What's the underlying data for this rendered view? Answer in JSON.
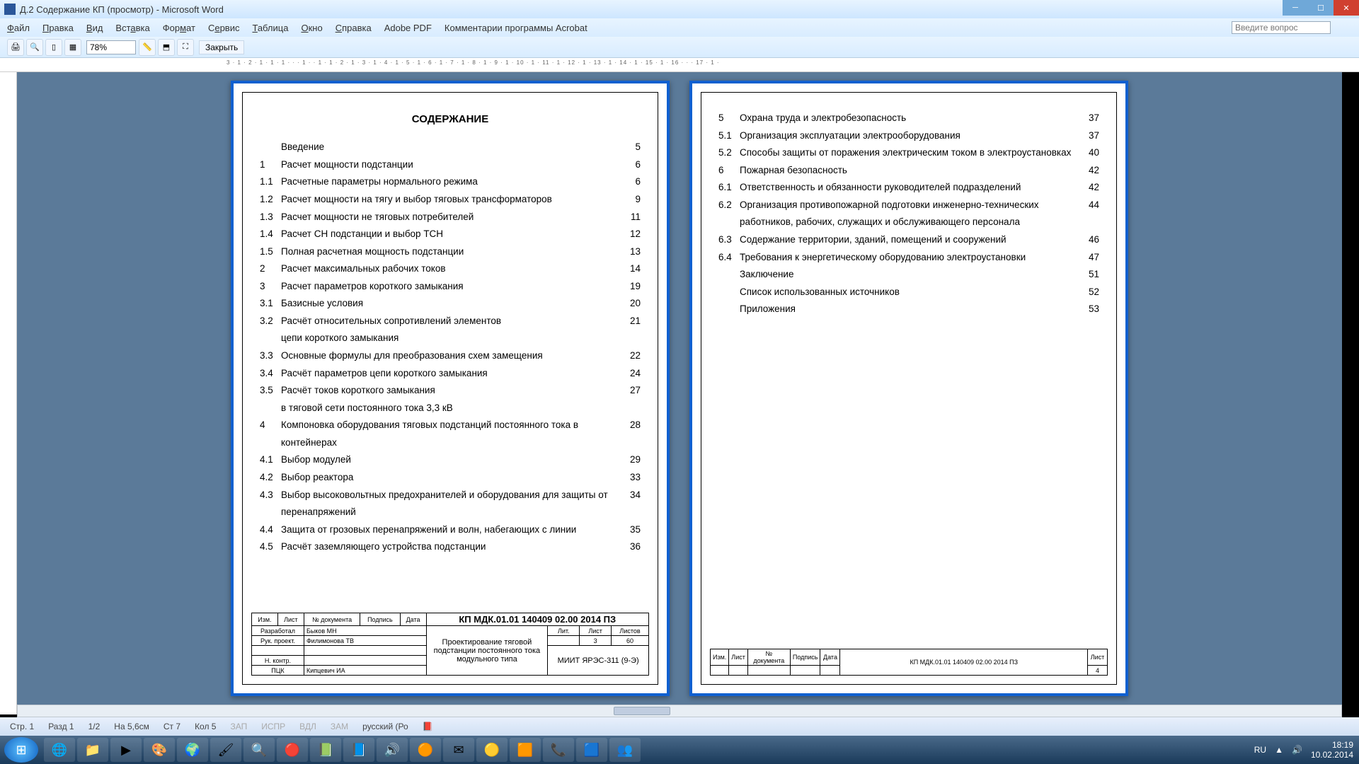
{
  "window": {
    "title": "Д.2 Содержание КП (просмотр) - Microsoft Word"
  },
  "menu": [
    "Файл",
    "Правка",
    "Вид",
    "Вставка",
    "Формат",
    "Сервис",
    "Таблица",
    "Окно",
    "Справка",
    "Adobe PDF",
    "Комментарии программы Acrobat"
  ],
  "help_placeholder": "Введите вопрос",
  "zoom": "78%",
  "close_label": "Закрыть",
  "ruler": "3 · 1 · 2 · 1 · 1 · 1 · · · 1 · · 1 · 1 · 2 · 1 · 3 · 1 · 4 · 1 · 5 · 1 · 6 · 1 · 7 · 1 · 8 · 1 · 9 · 1 · 10 · 1 · 11 · 1 · 12 · 1 · 13 · 1 · 14 · 1 · 15 · 1 · 16 · · · 17 · 1 ·",
  "heading": "СОДЕРЖАНИЕ",
  "toc1": [
    {
      "n": "",
      "t": "Введение",
      "p": "5"
    },
    {
      "n": "1",
      "t": "Расчет мощности подстанции",
      "p": "6"
    },
    {
      "n": "1.1",
      "t": "Расчетные параметры нормального режима",
      "p": "6"
    },
    {
      "n": "1.2",
      "t": "Расчет  мощности  на тягу и выбор тяговых трансформаторов",
      "p": "9"
    },
    {
      "n": "1.3",
      "t": "Расчет мощности не тяговых потребителей",
      "p": "11"
    },
    {
      "n": "1.4",
      "t": "Расчет СН подстанции и выбор ТСН",
      "p": "12"
    },
    {
      "n": "1.5",
      "t": "Полная расчетная мощность подстанции",
      "p": "13"
    },
    {
      "n": "2",
      "t": "Расчет максимальных рабочих токов",
      "p": "14"
    },
    {
      "n": "3",
      "t": "Расчет параметров короткого замыкания",
      "p": "19"
    },
    {
      "n": "3.1",
      "t": "Базисные условия",
      "p": "20"
    },
    {
      "n": "3.2",
      "t": "Расчёт относительных сопротивлений элементов",
      "p": "21"
    },
    {
      "n": "",
      "t": "цепи короткого замыкания",
      "p": ""
    },
    {
      "n": "3.3",
      "t": "Основные формулы для преобразования схем замещения",
      "p": "22"
    },
    {
      "n": "3.4",
      "t": "Расчёт параметров цепи короткого замыкания",
      "p": "24"
    },
    {
      "n": "3.5",
      "t": "Расчёт токов короткого замыкания",
      "p": "27"
    },
    {
      "n": "",
      "t": "в тяговой сети постоянного тока 3,3 кВ",
      "p": ""
    },
    {
      "n": "4",
      "t": "Компоновка оборудования тяговых подстанций постоянного тока в контейнерах",
      "p": "28"
    },
    {
      "n": "4.1",
      "t": "Выбор модулей",
      "p": "29"
    },
    {
      "n": "4.2",
      "t": "Выбор реактора",
      "p": "33"
    },
    {
      "n": "4.3",
      "t": "Выбор высоковольтных предохранителей и оборудования для защиты от перенапряжений",
      "p": "34"
    },
    {
      "n": "4.4",
      "t": "Защита от грозовых перенапряжений и волн, набегающих с линии",
      "p": "35"
    },
    {
      "n": "4.5",
      "t": "Расчёт заземляющего устройства подстанции",
      "p": "36"
    }
  ],
  "toc2": [
    {
      "n": "5",
      "t": "Охрана труда и электробезопасность",
      "p": "37"
    },
    {
      "n": "5.1",
      "t": "Организация эксплуатации электрооборудования",
      "p": "37"
    },
    {
      "n": "5.2",
      "t": "Способы защиты от поражения электрическим током в электроустановках",
      "p": "40"
    },
    {
      "n": "6",
      "t": "Пожарная безопасность",
      "p": "42"
    },
    {
      "n": "6.1",
      "t": "Ответственность и обязанности руководителей подразделений",
      "p": "42"
    },
    {
      "n": "6.2",
      "t": "Организация противопожарной подготовки инженерно-технических работников, рабочих, служащих и обслуживающего персонала",
      "p": "44"
    },
    {
      "n": "6.3",
      "t": "Содержание территории, зданий, помещений и сооружений",
      "p": "46"
    },
    {
      "n": "6.4",
      "t": "Требования к энергетическому оборудованию электроустановки",
      "p": "47"
    },
    {
      "n": "",
      "t": "Заключение",
      "p": "51"
    },
    {
      "n": "",
      "t": "Список использованных источников",
      "p": "52"
    },
    {
      "n": "",
      "t": "Приложения",
      "p": "53"
    }
  ],
  "stamp": {
    "code": "КП МДК.01.01 140409 02.00 2014 ПЗ",
    "headers": [
      "Изм.",
      "Лист",
      "№ документа",
      "Подпись",
      "Дата"
    ],
    "rows": [
      [
        "Разработал",
        "Быков МН"
      ],
      [
        "Рук. проект.",
        "Филимонова ТВ"
      ],
      [
        "",
        ""
      ],
      [
        "Н. контр.",
        ""
      ],
      [
        "ПЦК",
        "Кипцевич ИА"
      ]
    ],
    "project_title": "Проектирование тяговой подстанции постоянного тока модульного типа",
    "group": "МИИТ ЯРЭС-311 (9-Э)",
    "lit": "Лит.",
    "list": "Лист",
    "listov": "Листов",
    "list_val": "3",
    "listov_val": "60",
    "page2_list": "Лист",
    "page2_num": "4"
  },
  "status": {
    "page": "Стр. 1",
    "section": "Разд 1",
    "pages": "1/2",
    "pos": "На 5,6см",
    "line": "Ст 7",
    "col": "Кол 5",
    "modes": [
      "ЗАП",
      "ИСПР",
      "ВДЛ",
      "ЗАМ"
    ],
    "lang": "русский (Ро"
  },
  "tray": {
    "lang": "RU",
    "time": "18:19",
    "date": "10.02.2014"
  },
  "task_icons": [
    "🌐",
    "📁",
    "▶",
    "🎨",
    "🌍",
    "🖌",
    "🔍",
    "🔴",
    "📗",
    "📘",
    "🔊",
    "🟠",
    "✉",
    "🟡",
    "🟧",
    "📞",
    "🟦",
    "👥"
  ]
}
